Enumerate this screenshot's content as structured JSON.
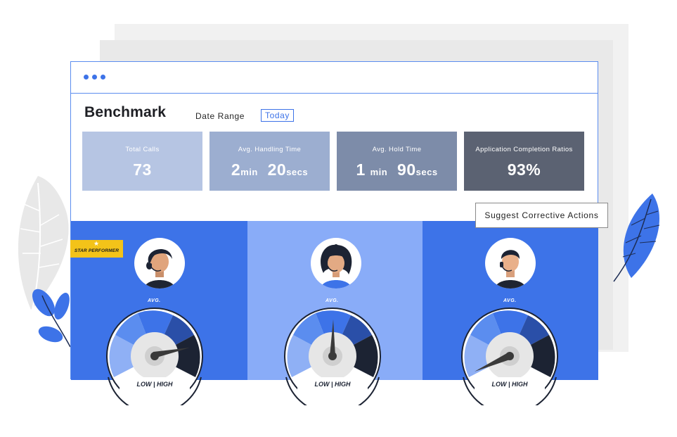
{
  "dashboard": {
    "title": "Benchmark",
    "date_range_label": "Date Range",
    "date_range_value": "Today"
  },
  "metrics": [
    {
      "label": "Total Calls",
      "value": "73",
      "color": "#b6c5e3"
    },
    {
      "label": "Avg. Handling Time",
      "value_a": "2",
      "unit_a": "min",
      "value_b": "20",
      "unit_b": "secs",
      "color": "#9caed0"
    },
    {
      "label": "Avg. Hold Time",
      "value_a": "1",
      "unit_a": "min",
      "value_b": "90",
      "unit_b": "secs",
      "color": "#7d8ca9"
    },
    {
      "label": "Application Completion Ratios",
      "value": "93%",
      "color": "#5b6272"
    }
  ],
  "suggest_button": "Suggest Corrective Actions",
  "star_badge": "STAR PERFORMER",
  "agents": [
    {
      "role": "star-performer",
      "avg_label": "AVG.",
      "gauge_label": "LOW | HIGH",
      "panel_color": "#3d73e8"
    },
    {
      "role": "average",
      "avg_label": "AVG.",
      "gauge_label": "LOW | HIGH",
      "panel_color": "#89acf8"
    },
    {
      "role": "low",
      "avg_label": "AVG.",
      "gauge_label": "LOW | HIGH",
      "panel_color": "#3d73e8"
    }
  ],
  "colors": {
    "accent": "#3d73e8",
    "badge": "#f3c319"
  },
  "icons": [
    "window-dots-icon",
    "star-icon",
    "leaf-icon"
  ]
}
